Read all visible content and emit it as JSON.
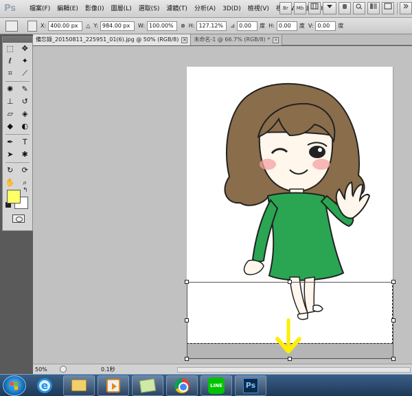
{
  "app": {
    "logo_text": "Ps"
  },
  "menubar": {
    "items": [
      "檔案(F)",
      "編輯(E)",
      "影像(I)",
      "圖層(L)",
      "選取(S)",
      "濾鏡(T)",
      "分析(A)",
      "3D(D)",
      "檢視(V)",
      "視窗(W)",
      "說明(H)"
    ],
    "right_buttons": [
      "Br",
      "Mb"
    ]
  },
  "options": {
    "x_label": "X:",
    "x_value": "400.00 px",
    "y_label": "Y:",
    "y_value": "984.00 px",
    "w_label": "W:",
    "w_value": "100.00%",
    "h_label": "H:",
    "h_value": "127.12%",
    "angle_value": "0.00",
    "angle_unit": "度",
    "hskew_label": "H:",
    "hskew_value": "0.00",
    "hskew_unit": "度",
    "vskew_label": "V:",
    "vskew_value": "0.00",
    "vskew_unit": "度"
  },
  "tabs": [
    {
      "label": "備忘錄_20150811_225951_01(6).jpg @ 50% (RGB/8)",
      "close": "×"
    },
    {
      "label": "未命名-1 @ 66.7% (RGB/8) *",
      "close": "×"
    }
  ],
  "colors": {
    "foreground": "#ffff66",
    "background": "#ffffff",
    "arrow": "#ffee00"
  },
  "status": {
    "zoom": "50%",
    "time": "0.1秒"
  },
  "taskbar": {
    "items": [
      "start",
      "internet-explorer",
      "file-explorer",
      "media-player",
      "sticky-notes",
      "chrome",
      "line",
      "photoshop"
    ],
    "line_label": "LINE",
    "ps_label": "Ps"
  }
}
